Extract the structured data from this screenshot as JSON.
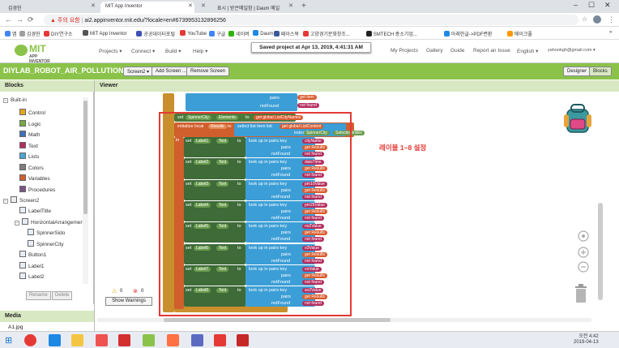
{
  "browser": {
    "tabs": [
      {
        "label": "김경헌",
        "active": false
      },
      {
        "label": "MIT App Inventor",
        "active": true
      },
      {
        "label": "",
        "active": false
      },
      {
        "label": "표시 | 받은메일함 | Daum 메일",
        "active": false
      }
    ],
    "security_label": "주의 요함",
    "url": "ai2.appinventor.mit.edu/?locale=en#6739953132896256",
    "bookmarks": [
      "앱",
      "김경헌",
      "DIY연구소",
      "MIT App Inventor",
      "공공데이터포털",
      "YouTube",
      "구글",
      "네이버",
      "Daum",
      "페이스북",
      "고양경기문화창조...",
      "SMTECH 중소기업...",
      "아래한글->PDF변환",
      "메이크풀"
    ],
    "bookmarks_more": "»"
  },
  "header": {
    "logo_title": "MIT",
    "logo_subtitle": "APP INVENTOR",
    "menus": [
      "Projects ▾",
      "Connect ▾",
      "Build ▾",
      "Help ▾"
    ],
    "right_links": [
      "My Projects",
      "Gallery",
      "Guide",
      "Report an Issue",
      "English ▾",
      "yahookgh@gmail.com ▾"
    ],
    "toast": "Saved project at Apr 13, 2019, 4:41:31 AM"
  },
  "project": {
    "name": "DIYLAB_ROBOT_AIR_POLLUTION1",
    "screen_button": "Screen2 ▾",
    "add_screen": "Add Screen ...",
    "remove_screen": "Remove Screen",
    "designer": "Designer",
    "blocks": "Blocks"
  },
  "blocks_panel": {
    "title": "Blocks",
    "builtin": "Built-in",
    "builtin_items": [
      {
        "label": "Control",
        "color": "#e1a91a"
      },
      {
        "label": "Logic",
        "color": "#77ab41"
      },
      {
        "label": "Math",
        "color": "#3f71b5"
      },
      {
        "label": "Text",
        "color": "#b32d5e"
      },
      {
        "label": "Lists",
        "color": "#49a6d4"
      },
      {
        "label": "Colors",
        "color": "#7d7d7d"
      },
      {
        "label": "Variables",
        "color": "#d05f2d"
      },
      {
        "label": "Procedures",
        "color": "#7c5385"
      }
    ],
    "screen": "Screen2",
    "components": [
      {
        "label": "LabelTitle",
        "indent": 1
      },
      {
        "label": "HorizontalArrangemen",
        "indent": 1
      },
      {
        "label": "SpinnerSido",
        "indent": 2
      },
      {
        "label": "SpinnerCity",
        "indent": 2
      },
      {
        "label": "Button1",
        "indent": 1
      },
      {
        "label": "Label1",
        "indent": 1
      },
      {
        "label": "Label2",
        "indent": 1
      }
    ],
    "rename": "Rename",
    "delete": "Delete",
    "media_title": "Media",
    "media_item": "A1.jpg"
  },
  "viewer": {
    "title": "Viewer",
    "annotation": "레이블 1~8 설정",
    "warnings_count": "0",
    "errors_count": "0",
    "show_warnings": "Show Warnings",
    "top_pairs": "pairs",
    "top_notfound": "notFound",
    "top_get_item": "get item",
    "top_not_found": "not found",
    "set_block": "set",
    "spinner": "SpinnerCity",
    "elements": "Elements",
    "to": "to",
    "get_global": "get global ListCityNames",
    "initialize_local": "initialize local",
    "results": "Results",
    "to2": "to",
    "select_list_item": "select list item list",
    "get_global_list": "get global ListContent",
    "index": "index",
    "selection_index": "SelectionIndex",
    "in": "in",
    "rows": [
      {
        "label": "Label1",
        "key": "cityName"
      },
      {
        "label": "Label2",
        "key": "dataTime"
      },
      {
        "label": "Label3",
        "key": "pm10Value"
      },
      {
        "label": "Label4",
        "key": "pm25Value"
      },
      {
        "label": "Label5",
        "key": "no2Value"
      },
      {
        "label": "Label6",
        "key": "o3Value"
      },
      {
        "label": "Label7",
        "key": "coValue"
      },
      {
        "label": "Label8",
        "key": "so2Value"
      }
    ],
    "text_prop": "Text",
    "lookup": "look up in pairs  key",
    "pairs": "pairs",
    "notFound": "notFound",
    "get_results": "get Results",
    "not_found": "not found"
  },
  "taskbar": {
    "time": "오전 4:42",
    "date": "2019-04-13"
  }
}
